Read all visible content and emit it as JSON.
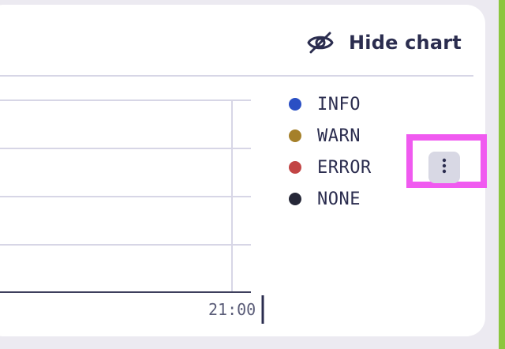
{
  "header": {
    "hide_chart_label": "Hide chart",
    "hide_chart_icon": "eye-off-icon"
  },
  "chart": {
    "x_tick_label": "21:00",
    "legend": [
      {
        "label": "INFO",
        "color": "#2a4fc4"
      },
      {
        "label": "WARN",
        "color": "#a5802a"
      },
      {
        "label": "ERROR",
        "color": "#c24545"
      },
      {
        "label": "NONE",
        "color": "#262838"
      }
    ],
    "options_icon": "more-vertical-icon"
  },
  "colors": {
    "highlight": "#f05af0",
    "text": "#2b2d4f",
    "grid": "#d7d6e6",
    "card": "#ffffff",
    "background": "#eceaf1",
    "accent_edge": "#8cc63f"
  }
}
